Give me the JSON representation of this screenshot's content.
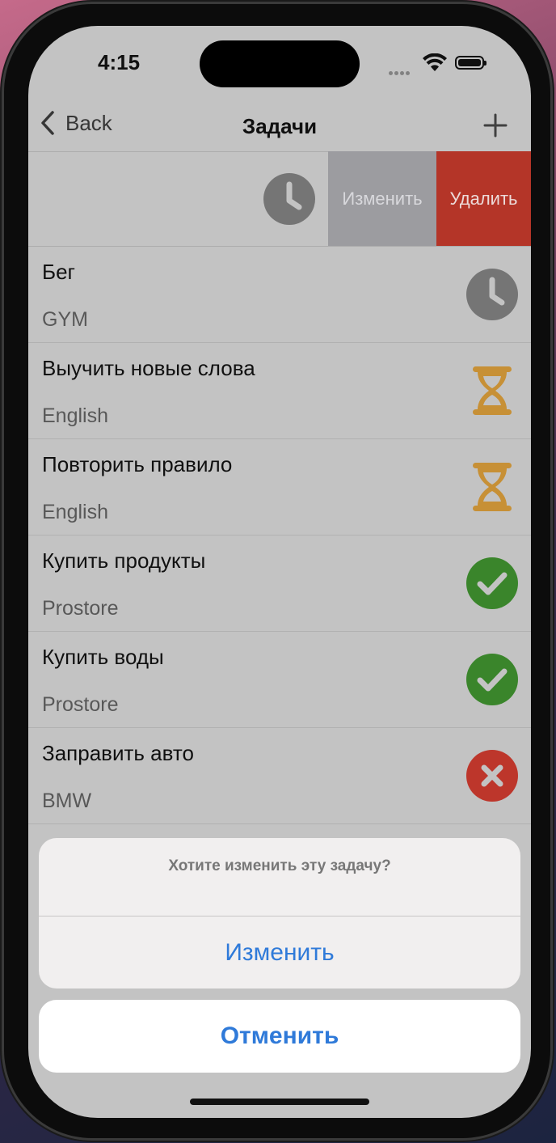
{
  "status_bar": {
    "time": "4:15"
  },
  "nav": {
    "back_label": "Back",
    "title": "Задачи"
  },
  "swipe_actions": {
    "edit_label": "Изменить",
    "delete_label": "Удалить"
  },
  "tasks": [
    {
      "title": "Бег",
      "category": "GYM",
      "status_icon": "clock-icon"
    },
    {
      "title": "Выучить новые слова",
      "category": "English",
      "status_icon": "hourglass-icon"
    },
    {
      "title": "Повторить правило",
      "category": "English",
      "status_icon": "hourglass-icon"
    },
    {
      "title": "Купить продукты",
      "category": "Prostore",
      "status_icon": "check-icon"
    },
    {
      "title": "Купить воды",
      "category": "Prostore",
      "status_icon": "check-icon"
    },
    {
      "title": "Заправить авто",
      "category": "BMW",
      "status_icon": "cross-icon"
    }
  ],
  "action_sheet": {
    "message": "Хотите изменить эту задачу?",
    "edit_label": "Изменить",
    "cancel_label": "Отменить"
  },
  "colors": {
    "accent_blue": "#2f7ad9",
    "delete_red": "#c0392b",
    "done_green": "#3e8e2e",
    "pending_gold": "#d49a3a",
    "clock_gray": "#7d7d7d",
    "failed_red": "#c93a2e"
  }
}
